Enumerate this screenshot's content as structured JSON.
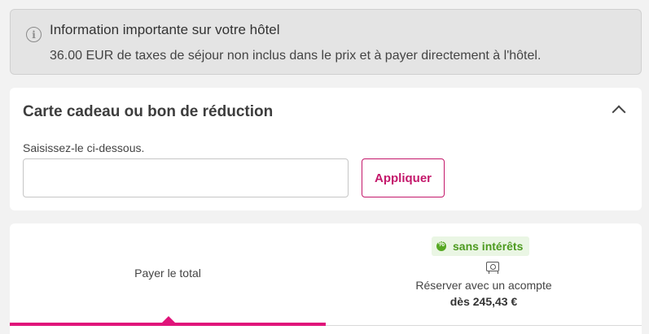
{
  "info": {
    "title": "Information importante sur votre hôtel",
    "text": "36.00 EUR de taxes de séjour non inclus dans le prix et à payer directement à l'hôtel.",
    "icon": "info-icon"
  },
  "coupon": {
    "title": "Carte cadeau ou bon de réduction",
    "label": "Saisissez-le ci-dessous.",
    "input_value": "",
    "input_placeholder": "",
    "apply_label": "Appliquer",
    "accent_color": "#c4186b"
  },
  "payment": {
    "tabs": [
      {
        "label": "Payer le total",
        "active": true
      },
      {
        "badge": "sans intérêts",
        "label": "Réserver avec un acompte",
        "price": "dès 245,43 €",
        "active": false
      }
    ],
    "active_color": "#e0147a",
    "badge_color": "#4c9a1f"
  }
}
